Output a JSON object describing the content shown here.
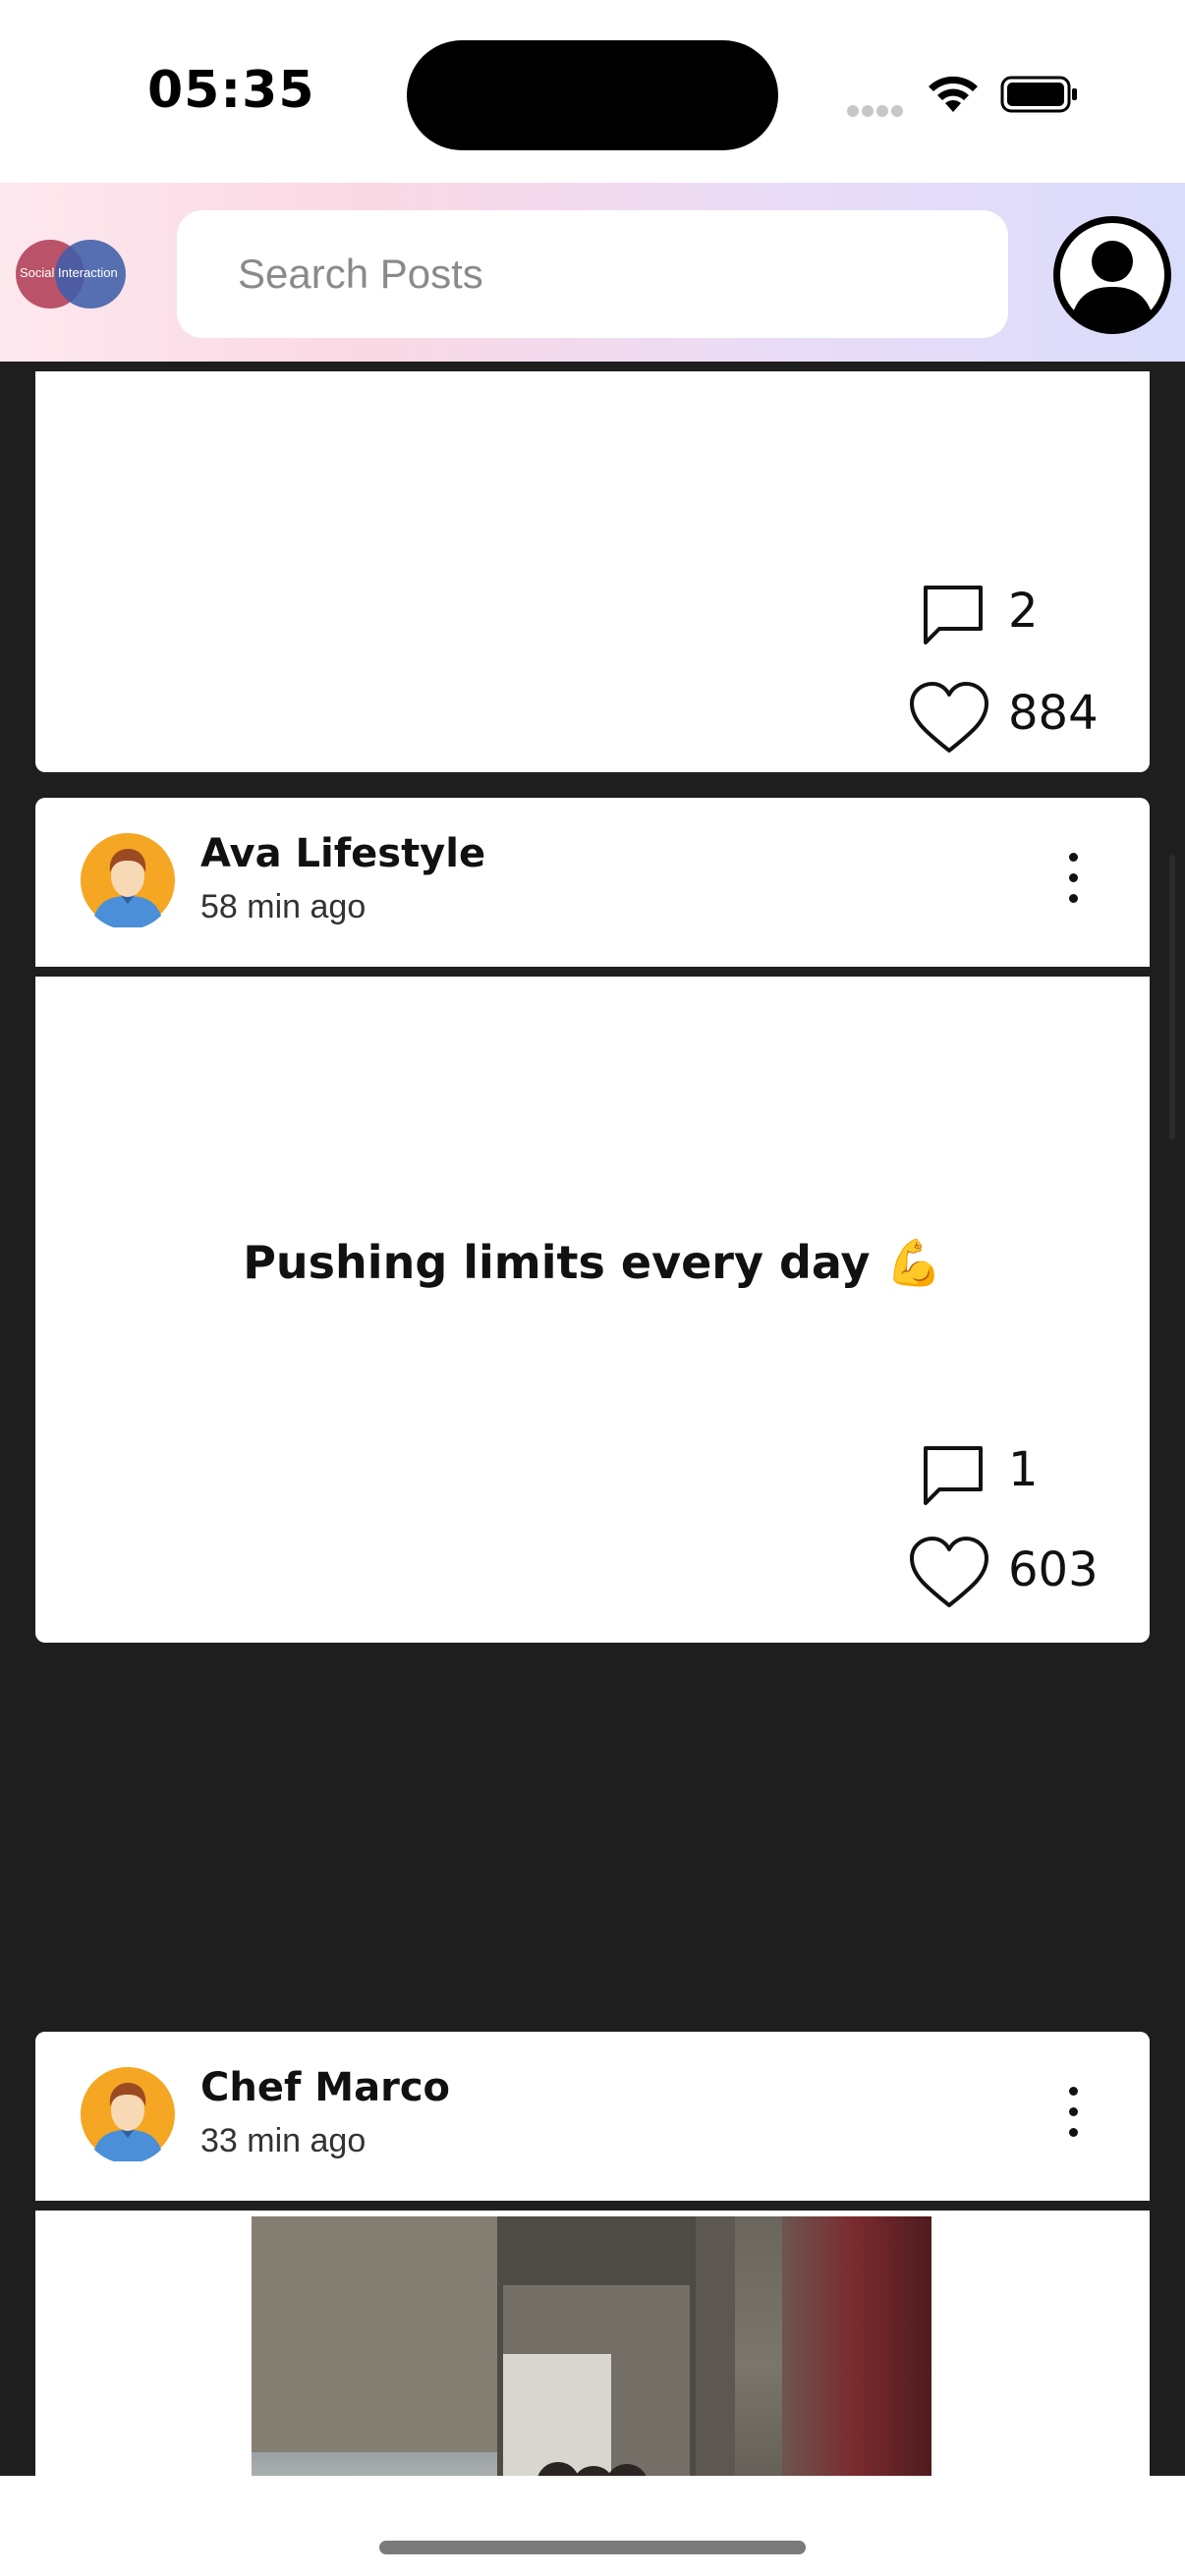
{
  "status_bar": {
    "time": "05:35",
    "icons": [
      "signal-icon",
      "wifi-icon",
      "battery-icon"
    ]
  },
  "header": {
    "logo_text": "Social Interaction",
    "search": {
      "placeholder": "Search Posts",
      "value": ""
    },
    "profile_icon": "user-avatar-icon"
  },
  "colors": {
    "feed_background": "#1e1e1e",
    "card_background": "#ffffff",
    "avatar_orange": "#f5a623",
    "header_gradient": [
      "#fde8ee",
      "#eadcf6",
      "#d9dcfb"
    ]
  },
  "posts": [
    {
      "comments": "2",
      "likes": "884"
    },
    {
      "author": "Ava Lifestyle",
      "time": "58 min ago",
      "text": "Pushing limits every day 💪",
      "comments": "1",
      "likes": "603"
    },
    {
      "author": "Chef Marco",
      "time": "33 min ago",
      "has_image": true
    }
  ]
}
